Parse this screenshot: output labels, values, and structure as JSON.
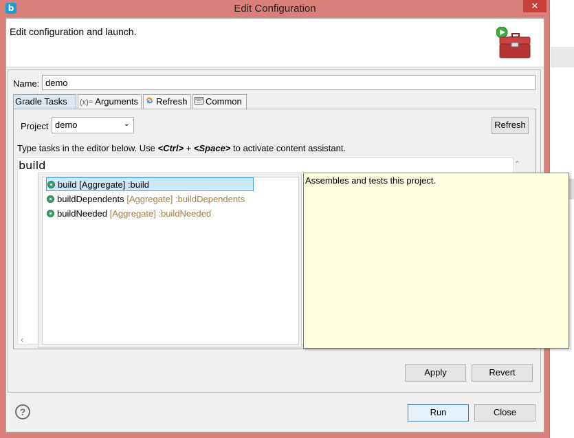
{
  "window": {
    "title": "Edit Configuration",
    "app_icon": "b",
    "close_glyph": "✕"
  },
  "header": {
    "text": "Edit configuration and launch.",
    "icon": "toolbox-run-icon"
  },
  "name": {
    "label": "Name:",
    "value": "demo"
  },
  "tabs": [
    {
      "label": "Gradle Tasks",
      "icon": "",
      "active": true
    },
    {
      "label": "Arguments",
      "icon": "(x)=",
      "active": false
    },
    {
      "label": "Refresh",
      "icon": "refresh-icon",
      "active": false
    },
    {
      "label": "Common",
      "icon": "common-tab-icon",
      "active": false
    }
  ],
  "gradle_tasks": {
    "project_label": "Project",
    "project_value": "demo",
    "refresh_button": "Refresh",
    "hint_prefix": "Type tasks in the editor below. Use ",
    "hint_ctrl": "<Ctrl>",
    "hint_plus": " + ",
    "hint_space": "<Space>",
    "hint_suffix": " to activate content assistant.",
    "editor_text": "build",
    "completions": [
      {
        "name": "build",
        "detail": "[Aggregate] :build",
        "selected": true
      },
      {
        "name": "buildDependents",
        "detail": "[Aggregate] :buildDependents",
        "selected": false
      },
      {
        "name": "buildNeeded",
        "detail": "[Aggregate] :buildNeeded",
        "selected": false
      }
    ],
    "doc_text": "Assembles and tests this project."
  },
  "buttons": {
    "apply": "Apply",
    "revert": "Revert",
    "run": "Run",
    "close": "Close",
    "help": "?"
  },
  "colors": {
    "frame": "#d9807a",
    "selection": "#cce8ff",
    "tooltip_bg": "#ffffe1"
  }
}
